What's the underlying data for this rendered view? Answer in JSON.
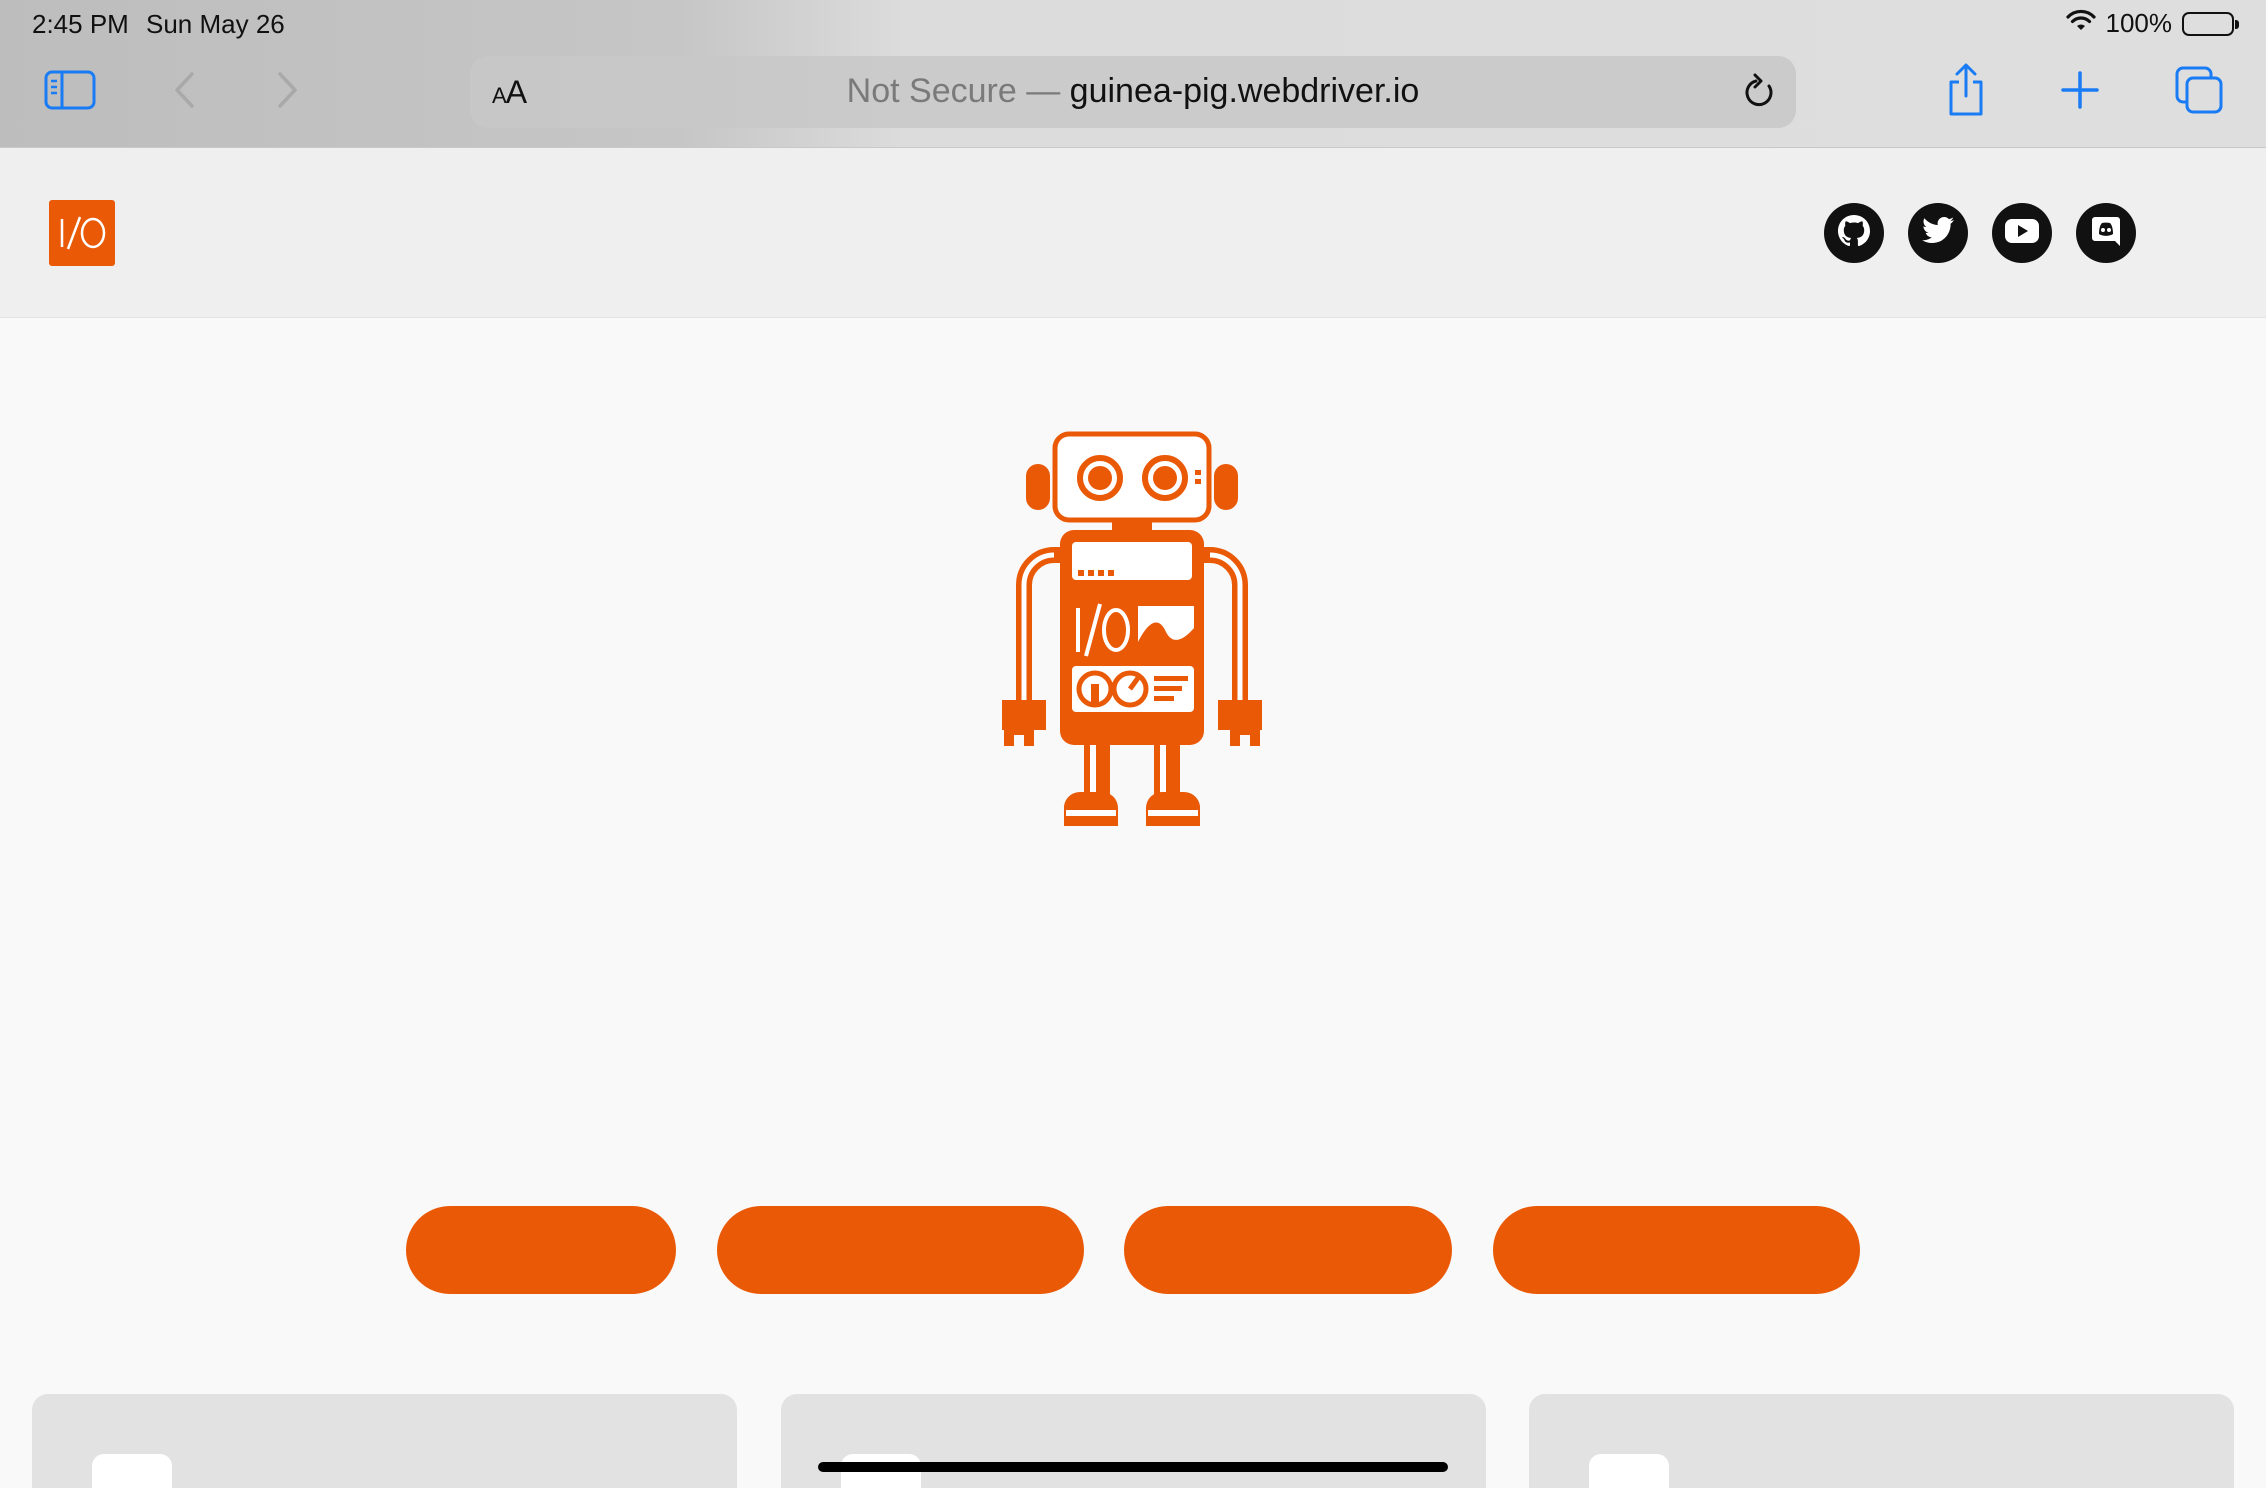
{
  "status_bar": {
    "time": "2:45 PM",
    "date": "Sun May 26",
    "battery": "100%"
  },
  "toolbar": {
    "reader_label_small": "A",
    "reader_label_large": "A",
    "url_security": "Not Secure —",
    "url_host": "guinea-pig.webdriver.io",
    "icons": [
      "sidebar-icon",
      "back-icon",
      "forward-icon",
      "reload-icon",
      "share-icon",
      "new-tab-icon",
      "tabs-icon"
    ]
  },
  "header": {
    "logo_text": "I/O",
    "social": [
      "github-icon",
      "twitter-icon",
      "youtube-icon",
      "discord-icon"
    ]
  },
  "hero": {
    "robot_screen_text": "I/O",
    "accent_color": "#ea5906"
  },
  "nav_buttons": [
    "",
    "",
    "",
    ""
  ],
  "cards": [
    "",
    "",
    ""
  ]
}
